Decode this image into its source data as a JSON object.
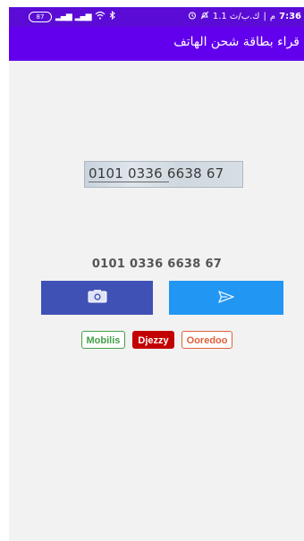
{
  "status_bar": {
    "time": "7:36",
    "am_pm": "م",
    "data_speed": "1.1 ك.ب/ث",
    "battery_level": "87",
    "icons": [
      "alarm-icon",
      "no-notifications-icon",
      "signal-icon",
      "signal-icon",
      "wifi-icon",
      "bluetooth-icon"
    ]
  },
  "app_bar": {
    "title": "قراء بطاقة شحن الهاتف"
  },
  "scanned_card": {
    "text": "0101 0336 6638 67"
  },
  "result": {
    "number": "0101 0336 6638 67"
  },
  "buttons": {
    "camera_icon": "camera-icon",
    "send_icon": "send-icon"
  },
  "operators": [
    {
      "label": "Mobilis"
    },
    {
      "label": "Djezzy"
    },
    {
      "label": "Ooredoo"
    }
  ],
  "colors": {
    "status_bar": "#5b0bd6",
    "app_bar": "#6200ee",
    "camera_button": "#3f51b5",
    "send_button": "#2196f3",
    "mobilis": "#43a047",
    "djezzy": "#c30000",
    "ooredoo": "#e0603a"
  }
}
